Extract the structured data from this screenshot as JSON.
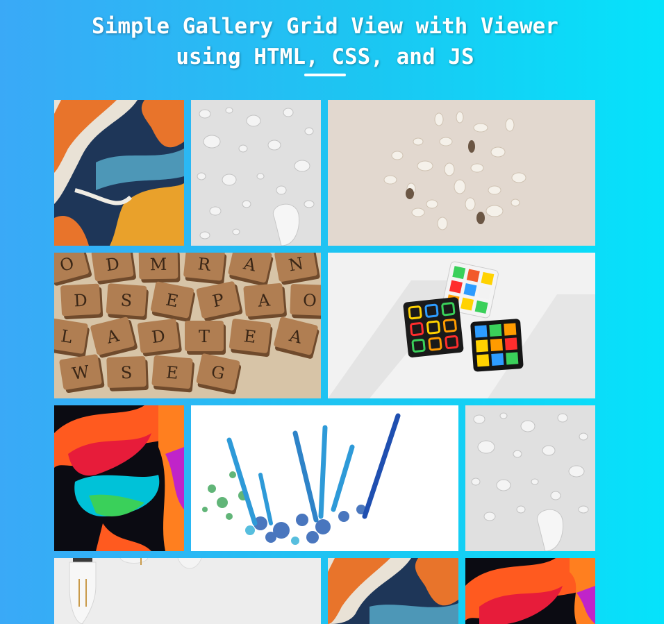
{
  "header": {
    "title_line1": "Simple Gallery Grid View with Viewer",
    "title_line2": "using HTML, CSS, and JS"
  },
  "gallery": {
    "images": [
      {
        "name": "fluid-art-orange-blue",
        "colors": [
          "#1d3457",
          "#e8742b",
          "#e9e2d6"
        ]
      },
      {
        "name": "water-droplets-white",
        "colors": [
          "#e2e2e2",
          "#d0d0d0",
          "#ffffff"
        ]
      },
      {
        "name": "cowrie-shells-beige",
        "colors": [
          "#e2d8cf",
          "#f4f0e8",
          "#4a3a2c"
        ]
      },
      {
        "name": "scrabble-tiles",
        "colors": [
          "#a0754e",
          "#e7d3b4",
          "#4d3320"
        ]
      },
      {
        "name": "rubiks-cubes",
        "colors": [
          "#f2f2f2",
          "#222222",
          "#f77f00"
        ]
      },
      {
        "name": "fluid-art-neon-black",
        "colors": [
          "#0b0b12",
          "#ff5a1f",
          "#00c2d8"
        ]
      },
      {
        "name": "blue-pencils-shavings",
        "colors": [
          "#ffffff",
          "#2e83c8",
          "#3aa357"
        ]
      },
      {
        "name": "water-droplets-white-2",
        "colors": [
          "#e2e2e2",
          "#d0d0d0",
          "#ffffff"
        ]
      },
      {
        "name": "light-bulbs",
        "colors": [
          "#ececec",
          "#dcdcdc",
          "#b59157"
        ]
      },
      {
        "name": "fluid-art-orange-blue-2",
        "colors": [
          "#1d3457",
          "#e8742b",
          "#e9e2d6"
        ]
      },
      {
        "name": "fluid-art-neon-black-2",
        "colors": [
          "#0b0b12",
          "#ff5a1f",
          "#00c2d8"
        ]
      }
    ]
  },
  "scrabble_letters": [
    "O",
    "D",
    "M",
    "R",
    "A",
    "N",
    "D",
    "S",
    "E",
    "P",
    "A",
    "O",
    "L",
    "A",
    "D",
    "T",
    "E",
    "A",
    "W",
    "S",
    "E",
    "G"
  ]
}
